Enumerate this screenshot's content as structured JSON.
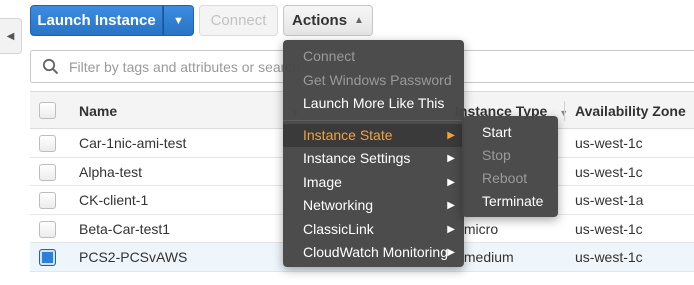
{
  "toolbar": {
    "launch_label": "Launch Instance",
    "connect_label": "Connect",
    "actions_label": "Actions"
  },
  "search": {
    "placeholder": "Filter by tags and attributes or search"
  },
  "table": {
    "columns": [
      "Name",
      "Instance Type",
      "Availability Zone"
    ],
    "rows": [
      {
        "name": "Car-1nic-ami-test",
        "type": "",
        "az": "us-west-1c",
        "selected": false
      },
      {
        "name": "Alpha-test",
        "type": "",
        "az": "us-west-1c",
        "selected": false
      },
      {
        "name": "CK-client-1",
        "type": "",
        "az": "us-west-1a",
        "selected": false
      },
      {
        "name": "Beta-Car-test1",
        "type": ".micro",
        "az": "us-west-1c",
        "selected": false
      },
      {
        "name": "PCS2-PCSvAWS",
        "type": ".medium",
        "az": "us-west-1c",
        "selected": true
      }
    ]
  },
  "actions_menu": {
    "items": [
      {
        "label": "Connect",
        "disabled": true
      },
      {
        "label": "Get Windows Password",
        "disabled": true
      },
      {
        "label": "Launch More Like This",
        "disabled": false
      },
      {
        "label": "Instance State",
        "submenu": true,
        "active": true
      },
      {
        "label": "Instance Settings",
        "submenu": true
      },
      {
        "label": "Image",
        "submenu": true
      },
      {
        "label": "Networking",
        "submenu": true
      },
      {
        "label": "ClassicLink",
        "submenu": true
      },
      {
        "label": "CloudWatch Monitoring",
        "submenu": true
      }
    ]
  },
  "instance_state_submenu": {
    "items": [
      {
        "label": "Start",
        "disabled": false
      },
      {
        "label": "Stop",
        "disabled": true
      },
      {
        "label": "Reboot",
        "disabled": true
      },
      {
        "label": "Terminate",
        "disabled": false
      }
    ]
  },
  "colors": {
    "primary_button": "#2f7ed8",
    "menu_background": "#464646",
    "menu_active_text": "#f3a23a",
    "selected_row": "#eef5fb"
  },
  "icons": [
    "chevron-left-icon",
    "caret-down-icon",
    "caret-up-icon",
    "search-icon",
    "sort-icon",
    "chevron-right-icon"
  ]
}
